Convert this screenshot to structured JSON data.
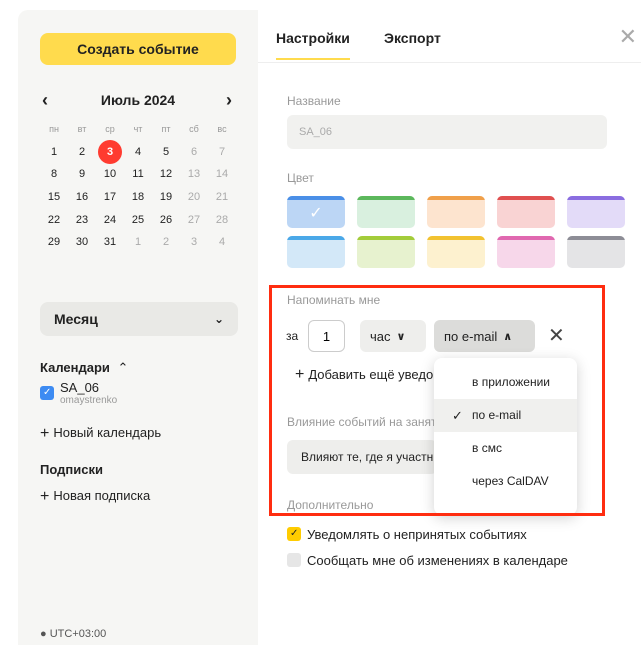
{
  "sidebar": {
    "create_button": "Создать событие",
    "calendar": {
      "month_label": "Июль 2024",
      "prev_icon": "chevron-left-icon",
      "next_icon": "chevron-right-icon",
      "weekdays": [
        "пн",
        "вт",
        "ср",
        "чт",
        "пт",
        "сб",
        "вс"
      ],
      "weeks": [
        [
          "1",
          "2",
          "3",
          "4",
          "5",
          "6",
          "7"
        ],
        [
          "8",
          "9",
          "10",
          "11",
          "12",
          "13",
          "14"
        ],
        [
          "15",
          "16",
          "17",
          "18",
          "19",
          "20",
          "21"
        ],
        [
          "22",
          "23",
          "24",
          "25",
          "26",
          "27",
          "28"
        ],
        [
          "29",
          "30",
          "31",
          "1",
          "2",
          "3",
          "4"
        ]
      ],
      "today": "3",
      "today_color": "#ff3b30"
    },
    "view_select": {
      "value": "Месяц",
      "icon": "chevron-down-icon"
    },
    "calendars_title": "Календари",
    "calendars_toggle_icon": "chevron-up-icon",
    "calendar_items": [
      {
        "name": "SA_06",
        "owner": "omaystrenko",
        "checked": true,
        "color": "#3d8bf2"
      }
    ],
    "new_calendar": "Новый календарь",
    "subscriptions_title": "Подписки",
    "new_subscription": "Новая подписка",
    "bottom_text": "UTC+03:00"
  },
  "panel": {
    "tabs": [
      {
        "label": "Настройки",
        "active": true
      },
      {
        "label": "Экспорт",
        "active": false
      }
    ],
    "close_icon": "close-icon",
    "name_label": "Название",
    "name_value": "SA_06",
    "color_label": "Цвет",
    "colors": [
      [
        {
          "fill": "#bcd6f5",
          "top": "#4a8fe7",
          "selected": true
        },
        {
          "fill": "#d9f0df",
          "top": "#5cb85c",
          "selected": false
        },
        {
          "fill": "#fde4cf",
          "top": "#f0a04a",
          "selected": false
        },
        {
          "fill": "#f9d3d3",
          "top": "#e05050",
          "selected": false
        },
        {
          "fill": "#e3dbf8",
          "top": "#8a6de0",
          "selected": false
        }
      ],
      [
        {
          "fill": "#d3e8f8",
          "top": "#4aa8e8",
          "selected": false
        },
        {
          "fill": "#e7f2cf",
          "top": "#a3cc3a",
          "selected": false
        },
        {
          "fill": "#fdf1cf",
          "top": "#f2c230",
          "selected": false
        },
        {
          "fill": "#f7d7ea",
          "top": "#e068b0",
          "selected": false
        },
        {
          "fill": "#e4e4e6",
          "top": "#8d8d96",
          "selected": false
        }
      ]
    ],
    "remind_label": "Напоминать мне",
    "remind": {
      "prefix": "за",
      "amount": "1",
      "unit": "час",
      "channel": "по e-mail",
      "remove_icon": "close-icon"
    },
    "add_reminder": "Добавить ещё уведомление",
    "impact_label": "Влияние событий на занятость",
    "impact_value": "Влияют те, где я участник",
    "extra_label": "Дополнительно",
    "dropdown": [
      {
        "label": "в приложении",
        "selected": false
      },
      {
        "label": "по e-mail",
        "selected": true
      },
      {
        "label": "в смс",
        "selected": false
      },
      {
        "label": "через CalDAV",
        "selected": false
      }
    ],
    "options": [
      {
        "label": "Уведомлять о непринятых событиях",
        "checked": true
      },
      {
        "label": "Сообщать мне об изменениях в календаре",
        "checked": false
      }
    ],
    "highlight_color": "#ff2d10",
    "accent_color": "#ffdb4d"
  }
}
